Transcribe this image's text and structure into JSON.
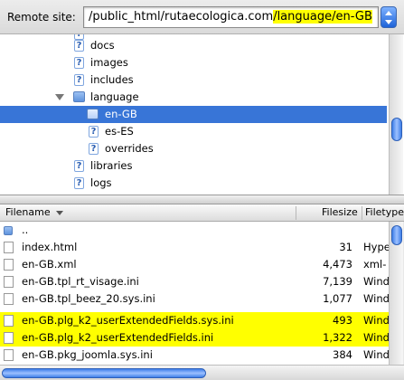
{
  "remote_site": {
    "label": "Remote site:",
    "path_prefix": "/public_html/rutaecologica.com",
    "path_highlight": "/language/en-GB"
  },
  "tree": {
    "items": [
      {
        "label": "docs",
        "icon": "question-folder-icon"
      },
      {
        "label": "images",
        "icon": "question-folder-icon"
      },
      {
        "label": "includes",
        "icon": "question-folder-icon"
      },
      {
        "label": "language",
        "icon": "folder-icon",
        "expanded": true
      },
      {
        "label": "en-GB",
        "icon": "folder-icon",
        "selected": true
      },
      {
        "label": "es-ES",
        "icon": "question-folder-icon"
      },
      {
        "label": "overrides",
        "icon": "question-folder-icon"
      },
      {
        "label": "libraries",
        "icon": "question-folder-icon"
      },
      {
        "label": "logs",
        "icon": "question-folder-icon"
      }
    ]
  },
  "list": {
    "columns": {
      "filename": "Filename",
      "filesize": "Filesize",
      "filetype": "Filetype"
    },
    "parent_label": "..",
    "rows": [
      {
        "name": "index.html",
        "size": "31",
        "type": "Hype"
      },
      {
        "name": "en-GB.xml",
        "size": "4,473",
        "type": "xml-"
      },
      {
        "name": "en-GB.tpl_rt_visage.ini",
        "size": "7,139",
        "type": "Wind"
      },
      {
        "name": "en-GB.tpl_beez_20.sys.ini",
        "size": "1,077",
        "type": "Wind"
      },
      {
        "name": "en-GB.plg_k2_userExtendedFields.sys.ini",
        "size": "493",
        "type": "Wind",
        "highlight": true
      },
      {
        "name": "en-GB.plg_k2_userExtendedFields.ini",
        "size": "1,322",
        "type": "Wind",
        "highlight": true
      },
      {
        "name": "en-GB.pkg_joomla.sys.ini",
        "size": "384",
        "type": "Wind"
      }
    ]
  },
  "colors": {
    "highlight": "#ffff00",
    "selection": "#3875d7"
  }
}
